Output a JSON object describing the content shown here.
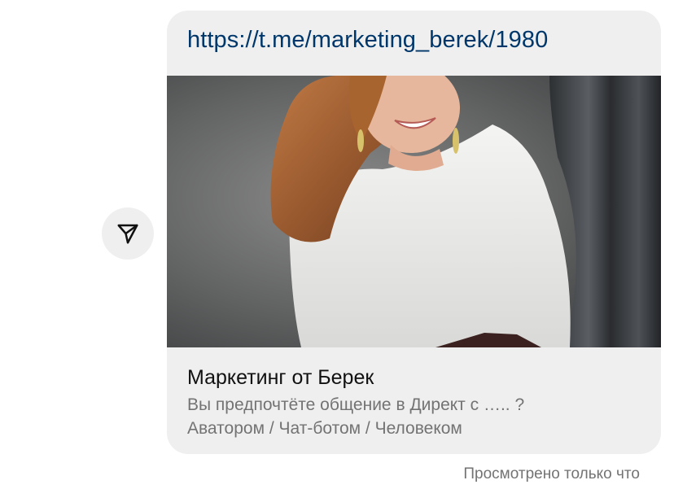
{
  "message": {
    "link_text": "https://t.me/marketing_berek/1980",
    "preview": {
      "title": "Маркетинг от Берек",
      "description_line1": "Вы предпочтёте общение в Директ с ….. ?",
      "description_line2": "Аватором / Чат-ботом / Человеком"
    },
    "status": "Просмотрено только что"
  },
  "icons": {
    "share": "send-arrow-icon"
  },
  "colors": {
    "bubble_bg": "#efefef",
    "link": "#00376b",
    "secondary_text": "#737373"
  }
}
